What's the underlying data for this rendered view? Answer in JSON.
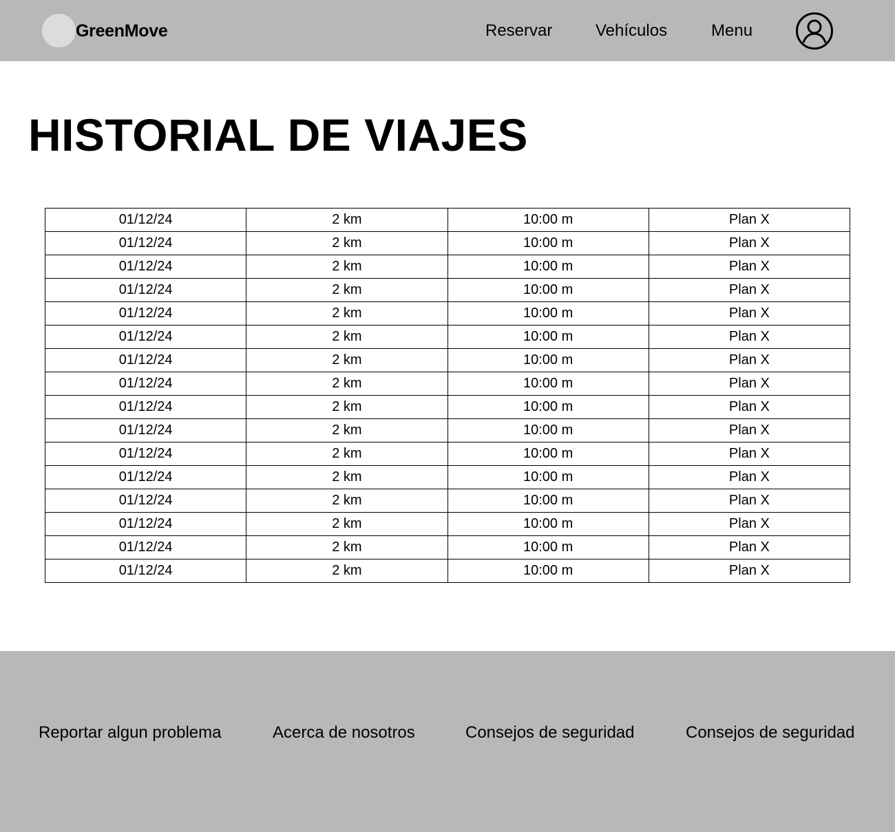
{
  "header": {
    "brand": "GreenMove",
    "nav": {
      "reservar": "Reservar",
      "vehiculos": "Vehículos",
      "menu": "Menu"
    },
    "avatar_icon": "user-circle-icon"
  },
  "main": {
    "title": "HISTORIAL DE VIAJES",
    "trips": [
      {
        "date": "01/12/24",
        "distance": "2 km",
        "time": "10:00 m",
        "plan": "Plan X"
      },
      {
        "date": "01/12/24",
        "distance": "2 km",
        "time": "10:00 m",
        "plan": "Plan X"
      },
      {
        "date": "01/12/24",
        "distance": "2 km",
        "time": "10:00 m",
        "plan": "Plan X"
      },
      {
        "date": "01/12/24",
        "distance": "2 km",
        "time": "10:00 m",
        "plan": "Plan X"
      },
      {
        "date": "01/12/24",
        "distance": "2 km",
        "time": "10:00 m",
        "plan": "Plan X"
      },
      {
        "date": "01/12/24",
        "distance": "2 km",
        "time": "10:00 m",
        "plan": "Plan X"
      },
      {
        "date": "01/12/24",
        "distance": "2 km",
        "time": "10:00 m",
        "plan": "Plan X"
      },
      {
        "date": "01/12/24",
        "distance": "2 km",
        "time": "10:00 m",
        "plan": "Plan X"
      },
      {
        "date": "01/12/24",
        "distance": "2 km",
        "time": "10:00 m",
        "plan": "Plan X"
      },
      {
        "date": "01/12/24",
        "distance": "2 km",
        "time": "10:00 m",
        "plan": "Plan X"
      },
      {
        "date": "01/12/24",
        "distance": "2 km",
        "time": "10:00 m",
        "plan": "Plan X"
      },
      {
        "date": "01/12/24",
        "distance": "2 km",
        "time": "10:00 m",
        "plan": "Plan X"
      },
      {
        "date": "01/12/24",
        "distance": "2 km",
        "time": "10:00 m",
        "plan": "Plan X"
      },
      {
        "date": "01/12/24",
        "distance": "2 km",
        "time": "10:00 m",
        "plan": "Plan X"
      },
      {
        "date": "01/12/24",
        "distance": "2 km",
        "time": "10:00 m",
        "plan": "Plan X"
      },
      {
        "date": "01/12/24",
        "distance": "2 km",
        "time": "10:00 m",
        "plan": "Plan X"
      }
    ]
  },
  "footer": {
    "links": [
      "Reportar algun problema",
      "Acerca de nosotros",
      "Consejos de seguridad",
      "Consejos de seguridad"
    ]
  },
  "colors": {
    "header_bg": "#b8b8b8",
    "footer_bg": "#b8b8b8",
    "logo_circle": "#dcdcdc",
    "text": "#000000"
  }
}
